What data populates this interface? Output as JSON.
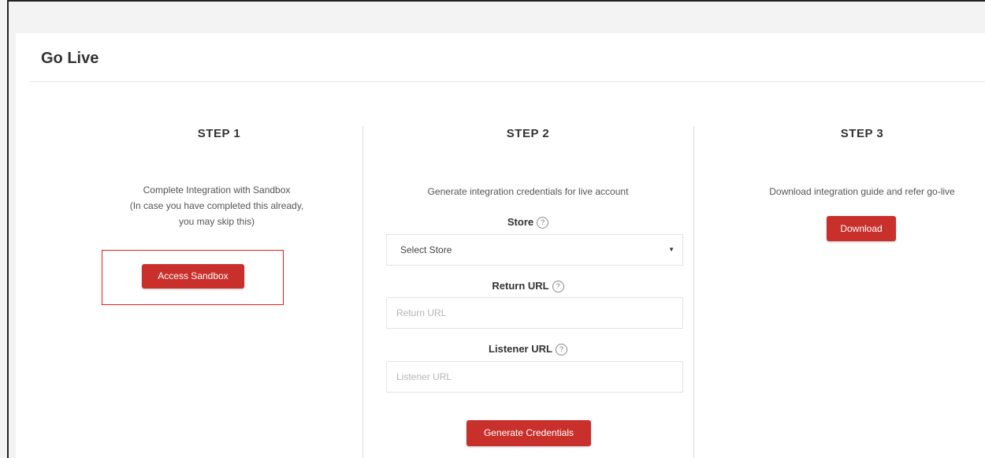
{
  "page": {
    "title": "Go Live"
  },
  "steps": [
    {
      "heading": "STEP 1",
      "description_lines": [
        "Complete Integration with Sandbox",
        "(In case you have completed this already,",
        "you may skip this)"
      ],
      "button_label": "Access Sandbox"
    },
    {
      "heading": "STEP 2",
      "description": "Generate integration credentials for live account",
      "store_label": "Store",
      "store_value": "Select Store",
      "return_url_label": "Return URL",
      "return_url_placeholder": "Return URL",
      "listener_url_label": "Listener URL",
      "listener_url_placeholder": "Listener URL",
      "button_label": "Generate Credentials"
    },
    {
      "heading": "STEP 3",
      "description": "Download integration guide and refer go-live",
      "button_label": "Download"
    }
  ],
  "icons": {
    "help": "question-circle-icon",
    "caret": "caret-down-icon"
  },
  "colors": {
    "accent": "#c9302c",
    "highlight": "#e02020"
  }
}
